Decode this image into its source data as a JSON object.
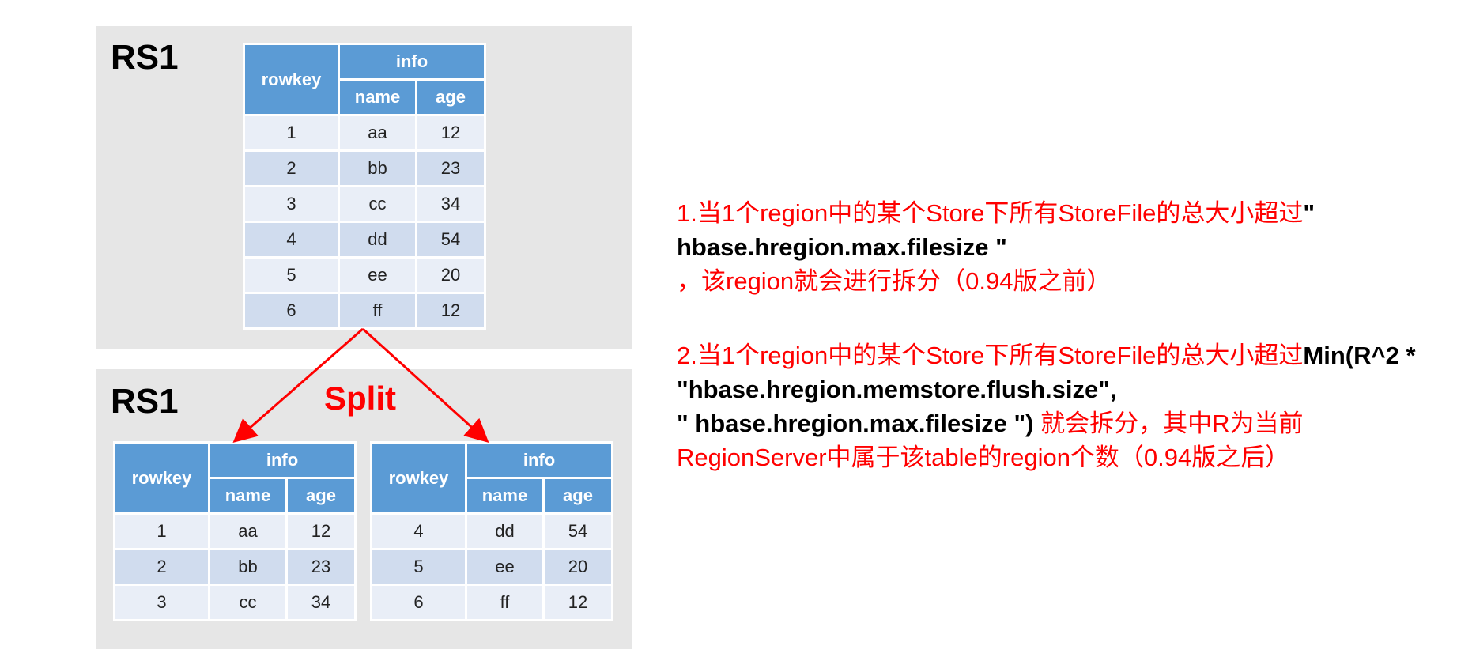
{
  "top_server": {
    "label": "RS1",
    "table": {
      "header": {
        "rowkey": "rowkey",
        "family": "info",
        "col1": "name",
        "col2": "age"
      },
      "rows": [
        {
          "rowkey": "1",
          "name": "aa",
          "age": "12"
        },
        {
          "rowkey": "2",
          "name": "bb",
          "age": "23"
        },
        {
          "rowkey": "3",
          "name": "cc",
          "age": "34"
        },
        {
          "rowkey": "4",
          "name": "dd",
          "age": "54"
        },
        {
          "rowkey": "5",
          "name": "ee",
          "age": "20"
        },
        {
          "rowkey": "6",
          "name": "ff",
          "age": "12"
        }
      ]
    }
  },
  "split_label": "Split",
  "bottom_server": {
    "label": "RS1",
    "left_table": {
      "header": {
        "rowkey": "rowkey",
        "family": "info",
        "col1": "name",
        "col2": "age"
      },
      "rows": [
        {
          "rowkey": "1",
          "name": "aa",
          "age": "12"
        },
        {
          "rowkey": "2",
          "name": "bb",
          "age": "23"
        },
        {
          "rowkey": "3",
          "name": "cc",
          "age": "34"
        }
      ]
    },
    "right_table": {
      "header": {
        "rowkey": "rowkey",
        "family": "info",
        "col1": "name",
        "col2": "age"
      },
      "rows": [
        {
          "rowkey": "4",
          "name": "dd",
          "age": "54"
        },
        {
          "rowkey": "5",
          "name": "ee",
          "age": "20"
        },
        {
          "rowkey": "6",
          "name": "ff",
          "age": "12"
        }
      ]
    }
  },
  "notes": {
    "note1": {
      "part1": "1.当1个region中的某个Store下所有StoreFile的总大小超过",
      "bold": "\" hbase.hregion.max.filesize \"",
      "part2": " ，该region就会进行拆分（0.94版之前）"
    },
    "note2": {
      "part1": "2.当1个region中的某个Store下所有StoreFile的总大小超过",
      "bold1": "Min(R^2 * \"hbase.hregion.memstore.flush.size\",",
      "bold2": "\" hbase.hregion.max.filesize \")",
      "part2": " 就会拆分，其中R为当前RegionServer中属于该table的region个数（0.94版之后）"
    }
  },
  "colors": {
    "header_blue": "#5b9bd5",
    "row_light": "#e9eef7",
    "row_dark": "#d0dcee",
    "accent_red": "#ff0000",
    "panel_gray": "#e6e6e6"
  }
}
